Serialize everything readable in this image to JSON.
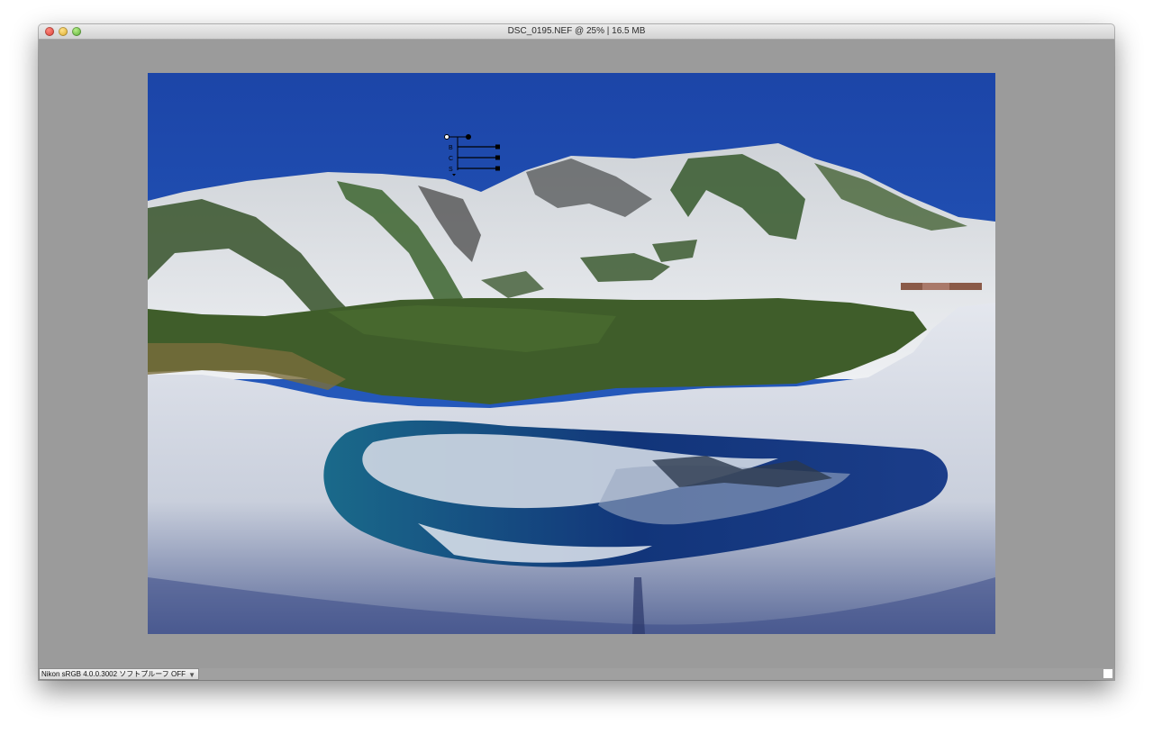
{
  "window": {
    "title": "DSC_0195.NEF @ 25%  |  16.5 MB"
  },
  "canvas": {
    "background_color": "#9b9b9b"
  },
  "photo": {
    "description_hint": "mountain-lake-landscape"
  },
  "hud": {
    "labels": [
      "B",
      "C",
      "S"
    ]
  },
  "statusbar": {
    "profile_label": "Nikon sRGB 4.0.0.3002  ソフトプルーフ OFF"
  },
  "icons": {
    "close": "close-icon",
    "minimize": "minimize-icon",
    "maximize": "maximize-icon",
    "dropdown": "chevron-down-icon",
    "resize": "resize-grip-icon"
  },
  "colors": {
    "close": "#d6352b",
    "minimize": "#d9a521",
    "maximize": "#4fa52a",
    "sky": "#1c4cae"
  }
}
